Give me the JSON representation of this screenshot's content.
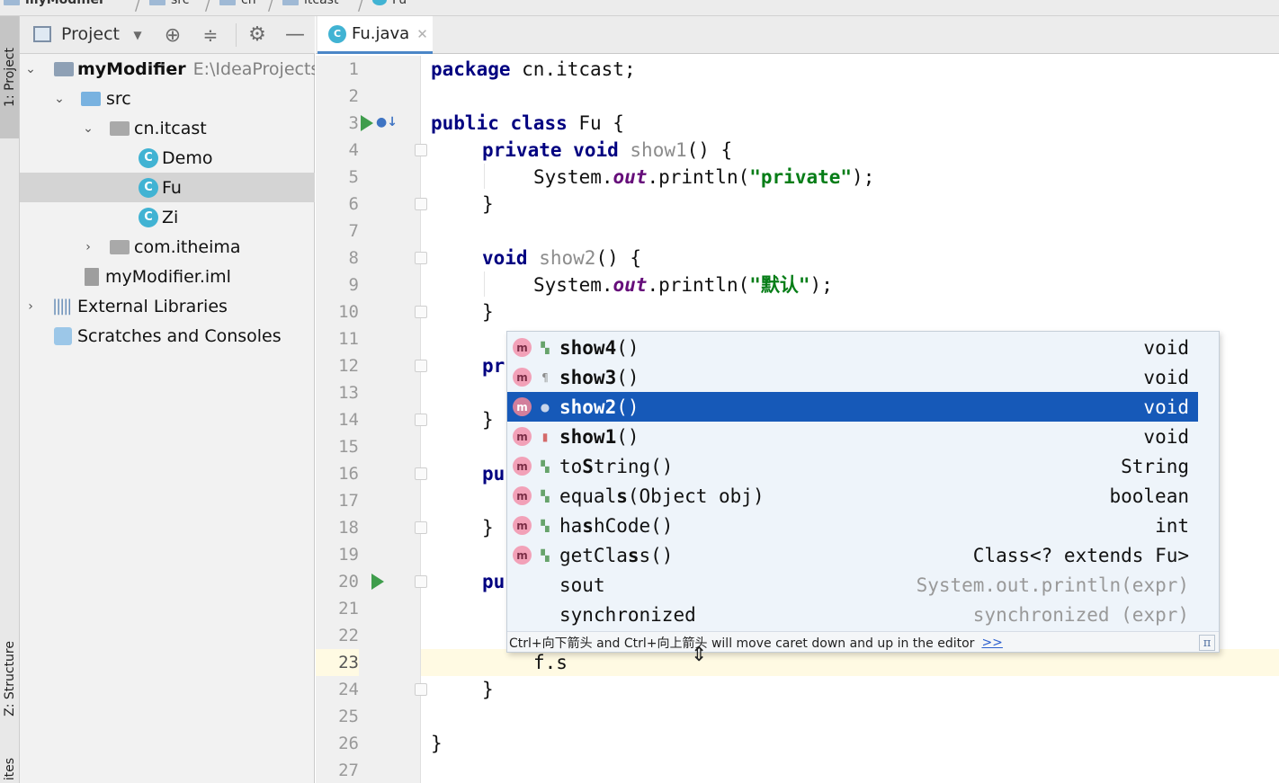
{
  "breadcrumb": [
    "myModifier",
    "src",
    "cn",
    "itcast",
    "Fu"
  ],
  "left_stripe": {
    "project": "1: Project",
    "structure": "Z: Structure",
    "favorites": "ites"
  },
  "project_panel": {
    "title": "Project",
    "tree": [
      {
        "label": "myModifier",
        "hint": "E:\\IdeaProjects\\",
        "icon": "module-folder-icon",
        "chevron": "expanded"
      },
      {
        "label": "src",
        "icon": "source-folder-icon",
        "chevron": "expanded"
      },
      {
        "label": "cn.itcast",
        "icon": "package-folder-icon",
        "chevron": "expanded"
      },
      {
        "label": "Demo",
        "icon": "java-class-icon"
      },
      {
        "label": "Fu",
        "icon": "java-class-icon",
        "selected": true
      },
      {
        "label": "Zi",
        "icon": "java-class-icon"
      },
      {
        "label": "com.itheima",
        "icon": "package-folder-icon",
        "chevron": "collapsed"
      },
      {
        "label": "myModifier.iml",
        "icon": "iml-file-icon"
      },
      {
        "label": "External Libraries",
        "icon": "libraries-icon",
        "chevron": "collapsed"
      },
      {
        "label": "Scratches and Consoles",
        "icon": "scratches-icon"
      }
    ]
  },
  "editor": {
    "tab_title": "Fu.java",
    "current_line": 23,
    "line_numbers": [
      "1",
      "2",
      "3",
      "4",
      "5",
      "6",
      "7",
      "8",
      "9",
      "10",
      "11",
      "12",
      "13",
      "14",
      "15",
      "16",
      "17",
      "18",
      "19",
      "20",
      "21",
      "22",
      "23",
      "24",
      "25",
      "26",
      "27"
    ],
    "visible_code": {
      "l1_kw": "package",
      "l1_rest": " cn.itcast;",
      "l3_kw1": "public",
      "l3_kw2": "class",
      "l3_rest": " Fu {",
      "l4_kw1": "private",
      "l4_kw2": "void",
      "l4_name": "show1",
      "l4_rest": "() {",
      "l5_a": "System.",
      "l5_out": "out",
      "l5_b": ".println(",
      "l5_str": "\"private\"",
      "l5_c": ");",
      "l6": "}",
      "l8_kw": "void",
      "l8_name": "show2",
      "l8_rest": "() {",
      "l9_a": "System.",
      "l9_out": "out",
      "l9_b": ".println(",
      "l9_str": "\"默认\"",
      "l9_c": ");",
      "l10": "}",
      "l12": "pr",
      "l14": "}",
      "l16": "pu",
      "l18": "}",
      "l20": "pu",
      "l23": "f.s",
      "l24": "}",
      "l26": "}"
    }
  },
  "completion": {
    "items": [
      {
        "bold": "show4",
        "rest": "()",
        "type": "void",
        "visibility": "public"
      },
      {
        "bold": "show3",
        "rest": "()",
        "type": "void",
        "visibility": "protected"
      },
      {
        "bold": "show2",
        "rest": "()",
        "type": "void",
        "visibility": "package",
        "selected": true
      },
      {
        "bold": "show1",
        "rest": "()",
        "type": "void",
        "visibility": "private"
      },
      {
        "pre": "to",
        "s": "S",
        "post": "tring()",
        "type": "String",
        "visibility": "public"
      },
      {
        "pre": "equal",
        "s": "s",
        "post": "(Object obj)",
        "type": "boolean",
        "visibility": "public"
      },
      {
        "pre": "ha",
        "s": "s",
        "post": "hCode()",
        "type": "int",
        "visibility": "public"
      },
      {
        "pre": "getCla",
        "s": "s",
        "post": "s()",
        "type": "Class<? extends Fu>",
        "visibility": "public"
      },
      {
        "pre": "",
        "s": "s",
        "post": "out",
        "type": "System.out.println(expr)",
        "template": true
      },
      {
        "pre": "",
        "s": "s",
        "post": "ynchronized",
        "type": "synchronized (expr)",
        "template": true
      }
    ],
    "hint_text": "Ctrl+向下箭头 and Ctrl+向上箭头 will move caret down and up in the editor",
    "hint_link": ">>",
    "hint_icon": "π"
  }
}
